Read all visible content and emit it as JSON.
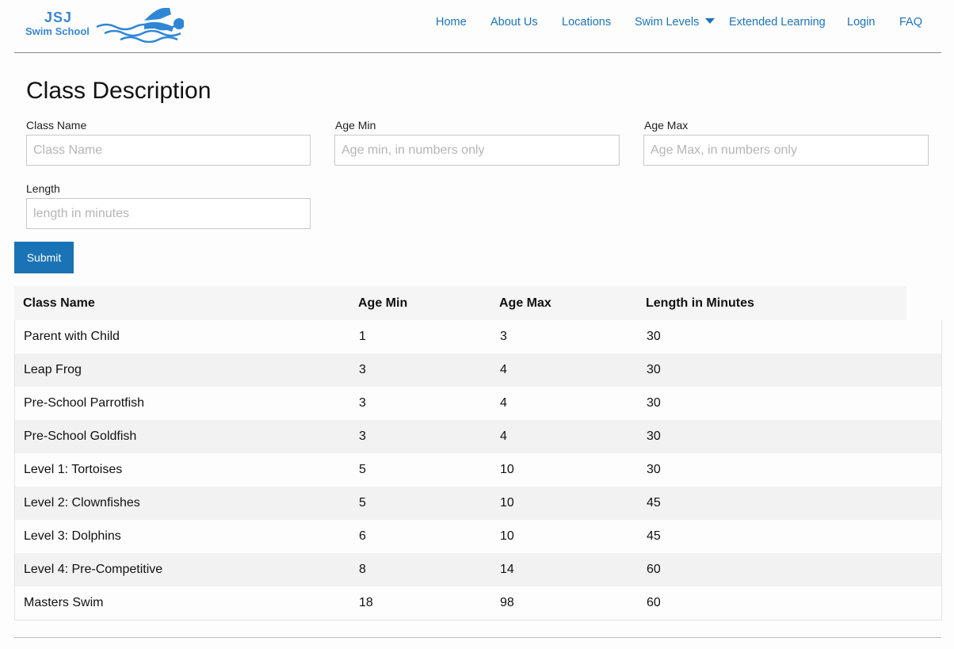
{
  "logo": {
    "line1": "JSJ",
    "line2": "Swim School"
  },
  "nav": {
    "items": [
      {
        "label": "Home"
      },
      {
        "label": "About Us"
      },
      {
        "label": "Locations"
      },
      {
        "label": "Swim Levels"
      },
      {
        "label": "Extended Learning"
      },
      {
        "label": "Login"
      },
      {
        "label": "FAQ"
      }
    ]
  },
  "colors": {
    "accent": "#1a73b5",
    "link": "#1f73b7"
  },
  "page": {
    "title": "Class Description"
  },
  "form": {
    "class_name": {
      "label": "Class Name",
      "placeholder": "Class Name",
      "value": ""
    },
    "age_min": {
      "label": "Age Min",
      "placeholder": "Age min, in numbers only",
      "value": ""
    },
    "age_max": {
      "label": "Age Max",
      "placeholder": "Age Max, in numbers only",
      "value": ""
    },
    "length": {
      "label": "Length",
      "placeholder": "length in minutes",
      "value": ""
    },
    "submit_label": "Submit"
  },
  "table": {
    "columns": [
      "Class Name",
      "Age Min",
      "Age Max",
      "Length in Minutes"
    ],
    "rows": [
      [
        "Parent with Child",
        "1",
        "3",
        "30"
      ],
      [
        "Leap Frog",
        "3",
        "4",
        "30"
      ],
      [
        "Pre-School Parrotfish",
        "3",
        "4",
        "30"
      ],
      [
        "Pre-School Goldfish",
        "3",
        "4",
        "30"
      ],
      [
        "Level 1: Tortoises",
        "5",
        "10",
        "30"
      ],
      [
        "Level 2: Clownfishes",
        "5",
        "10",
        "45"
      ],
      [
        "Level 3: Dolphins",
        "6",
        "10",
        "45"
      ],
      [
        "Level 4: Pre-Competitive",
        "8",
        "14",
        "60"
      ],
      [
        "Masters Swim",
        "18",
        "98",
        "60"
      ]
    ]
  }
}
